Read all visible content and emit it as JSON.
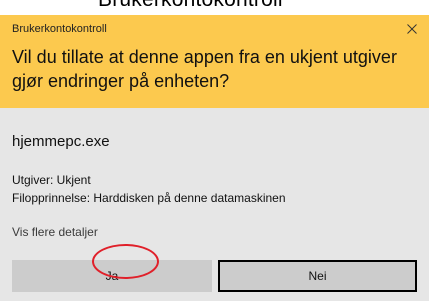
{
  "page": {
    "caption": "Brukerkontokontroll"
  },
  "dialog": {
    "title": "Brukerkontokontroll",
    "close_icon": "close-icon",
    "question": "Vil du tillate at denne appen fra en ukjent utgiver gjør endringer på enheten?",
    "file_name": "hjemmepc.exe",
    "publisher": "Utgiver: Ukjent",
    "origin": "Filopprinnelse: Harddisken på denne datamaskinen",
    "details_link": "Vis flere detaljer",
    "yes_label": "Ja",
    "no_label": "Nei"
  },
  "colors": {
    "header": "#fcc94e",
    "body": "#e6e6e6",
    "button": "#cccccc",
    "highlight": "#e0202a"
  }
}
